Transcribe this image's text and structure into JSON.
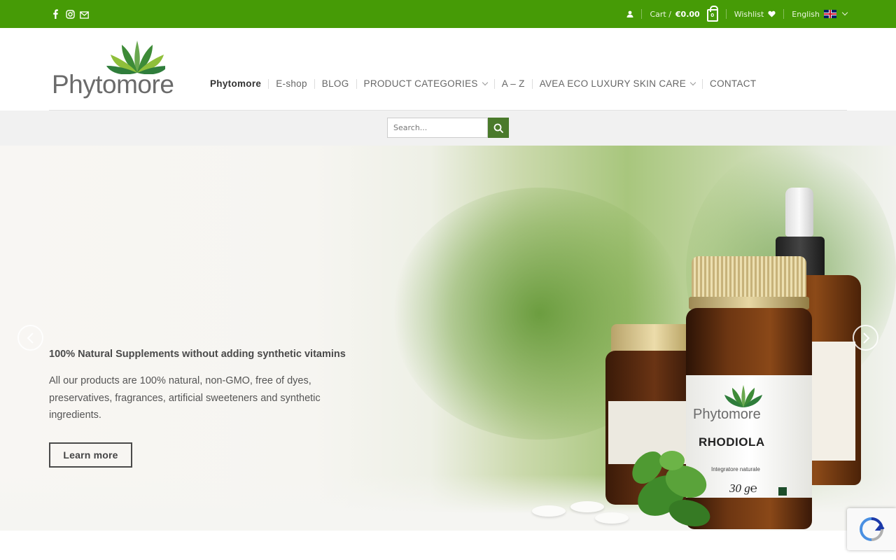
{
  "topbar": {
    "social_icons": [
      "facebook-icon",
      "instagram-icon",
      "envelope-icon"
    ],
    "account_icon": "user-icon",
    "cart_label": "Cart /",
    "cart_total": "€0.00",
    "cart_count": "0",
    "wishlist_label": "Wishlist",
    "wishlist_icon": "heart-icon",
    "language_label": "English",
    "bar_color": "#469b06"
  },
  "header": {
    "logo_text": "Phytomore",
    "nav": [
      {
        "label": "Phytomore",
        "active": true
      },
      {
        "label": "E-shop"
      },
      {
        "label": "BLOG"
      },
      {
        "label": "PRODUCT CATEGORIES",
        "dropdown": true
      },
      {
        "label": "A – Z"
      },
      {
        "label": "AVEA ECO LUXURY SKIN CARE",
        "dropdown": true
      },
      {
        "label": "CONTACT"
      }
    ]
  },
  "search": {
    "placeholder": "Search...",
    "button_color": "#4a7a2b"
  },
  "hero": {
    "title": "100% Natural Supplements without adding synthetic vitamins",
    "body": "All our products are 100% natural, non-GMO, free of dyes, preservatives, fragrances, artificial sweeteners and synthetic ingredients.",
    "cta_label": "Learn more",
    "product": {
      "brand": "Phytomore",
      "name": "RHODIOLA",
      "sub": "Integratore naturale",
      "weight": "30 g℮"
    }
  }
}
